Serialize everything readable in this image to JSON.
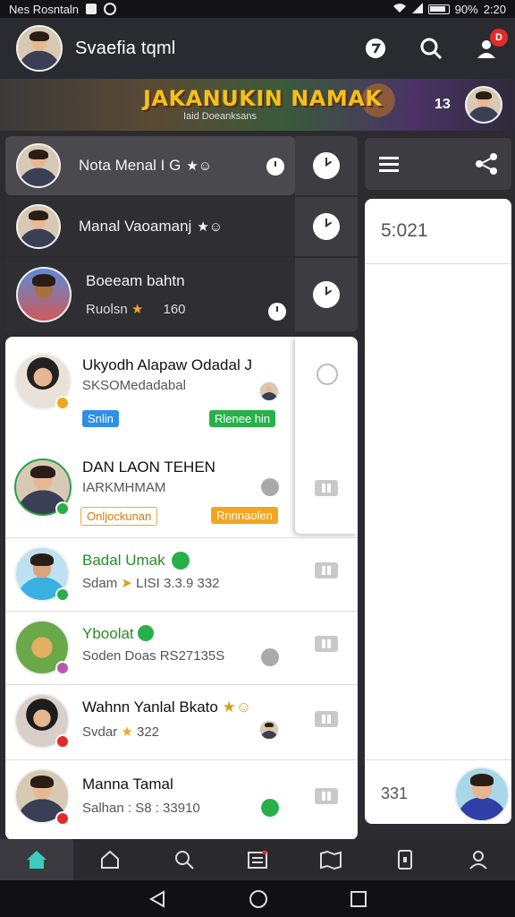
{
  "status_bar": {
    "carrier": "Nes Rosntaln",
    "battery": "90%",
    "time": "2:20"
  },
  "header": {
    "title": "Svaefia tqml",
    "notification_count": "D"
  },
  "banner": {
    "title": "JAKANUKIN NAMAK",
    "subtitle": "Iaid Doeanksans",
    "count": "13"
  },
  "dark_chats": [
    {
      "name": "Nota Menal I G"
    },
    {
      "name": "Manal Vaoamanj"
    },
    {
      "name": "Boeeam bahtn",
      "sub": "Ruolsn",
      "count": "160"
    }
  ],
  "contacts": [
    {
      "name": "Ukyodh Alapaw Odadal J",
      "sub": "SKSOMedadabal",
      "tag_left": "Snlin",
      "tag_right": "Rlenee hin"
    },
    {
      "name": "DAN LAON TEHEN",
      "sub": "IARKMHMAM",
      "tag_left": "Onljockunan",
      "tag_right": "Rnnnaolen"
    },
    {
      "name": "Badal Umak",
      "sub": "Sdam",
      "meta": "LISI 3.3.9 332"
    },
    {
      "name": "Yboolat",
      "sub": "Soden Doas RS27135S"
    },
    {
      "name": "Wahnn Yanlal Bkato",
      "sub": "Svdar",
      "meta": "322"
    },
    {
      "name": "Manna Tamal",
      "sub": "Salhan : S8 : 33910"
    }
  ],
  "right_panel": {
    "time": "5:021",
    "count": "331"
  },
  "icons": {
    "header": [
      "chat-bubble-icon",
      "search-icon",
      "user-notification-icon"
    ],
    "bottom_nav": [
      "home-icon",
      "house-outline-icon",
      "search-icon",
      "news-icon",
      "map-icon",
      "device-icon",
      "profile-icon"
    ],
    "system_nav": [
      "back-icon",
      "home-circle-icon",
      "recents-icon"
    ]
  },
  "colors": {
    "accent_green": "#28b04a",
    "accent_blue": "#2e8fe8",
    "accent_orange": "#f2a51e",
    "banner_gold": "#f2c21b",
    "home_active": "#3ec9c1"
  }
}
